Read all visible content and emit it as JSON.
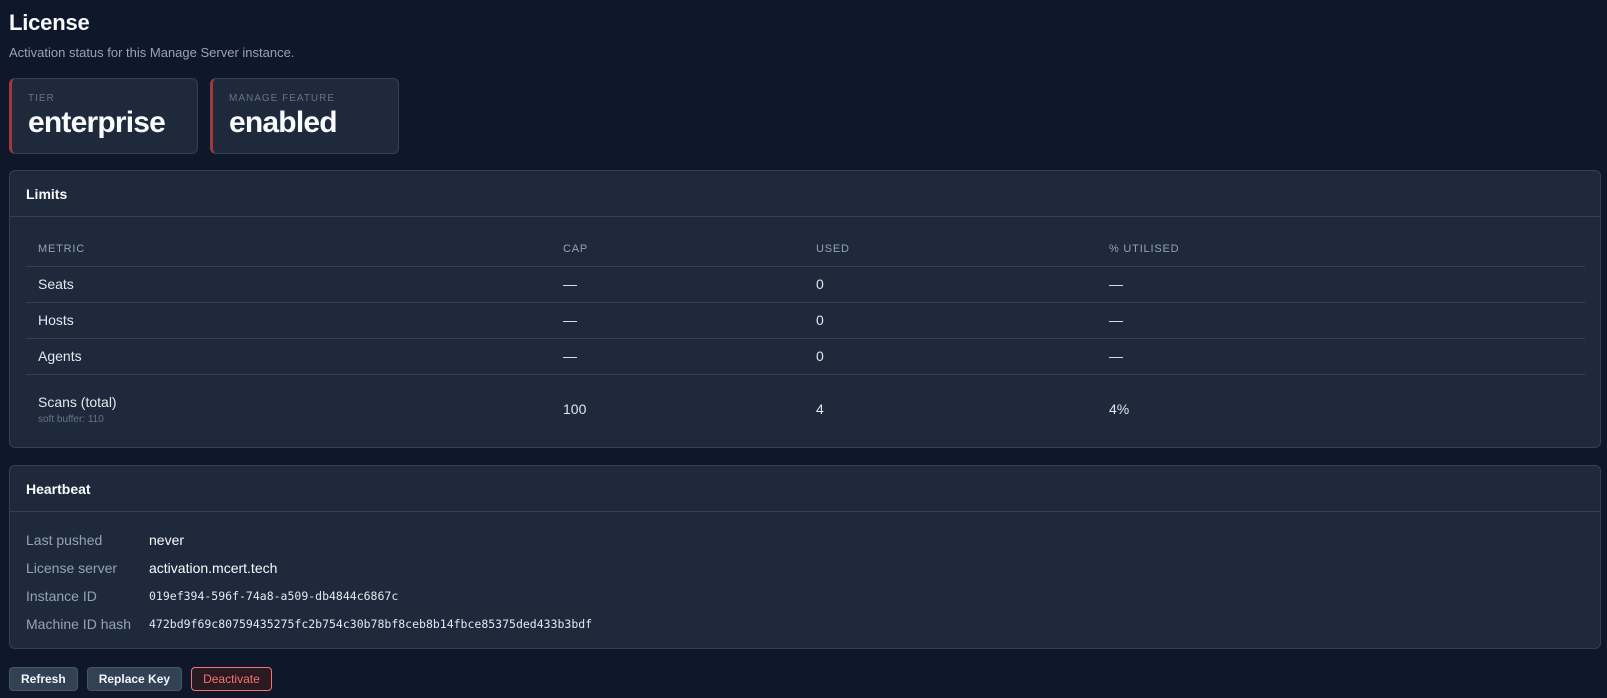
{
  "page": {
    "title": "License",
    "subtitle": "Activation status for this Manage Server instance."
  },
  "stats": [
    {
      "label": "TIER",
      "value": "enterprise"
    },
    {
      "label": "MANAGE FEATURE",
      "value": "enabled"
    }
  ],
  "limits": {
    "title": "Limits",
    "columns": [
      "METRIC",
      "CAP",
      "USED",
      "% UTILISED"
    ],
    "rows": [
      {
        "metric": "Seats",
        "sub": "",
        "cap": "—",
        "used": "0",
        "pct": "—"
      },
      {
        "metric": "Hosts",
        "sub": "",
        "cap": "—",
        "used": "0",
        "pct": "—"
      },
      {
        "metric": "Agents",
        "sub": "",
        "cap": "—",
        "used": "0",
        "pct": "—"
      },
      {
        "metric": "Scans (total)",
        "sub": "soft buffer: 110",
        "cap": "100",
        "used": "4",
        "pct": "4%"
      }
    ]
  },
  "heartbeat": {
    "title": "Heartbeat",
    "items": [
      {
        "key": "Last pushed",
        "value": "never"
      },
      {
        "key": "License server",
        "value": "activation.mcert.tech"
      },
      {
        "key": "Instance ID",
        "value": "019ef394-596f-74a8-a509-db4844c6867c"
      },
      {
        "key": "Machine ID hash",
        "value": "472bd9f69c80759435275fc2b754c30b78bf8ceb8b14fbce85375ded433b3bdf"
      }
    ]
  },
  "actions": {
    "refresh": "Refresh",
    "replace_key": "Replace Key",
    "deactivate": "Deactivate"
  },
  "colors": {
    "background": "#0f172a",
    "panel": "#1e293b",
    "accent_border": "#9f3a3a",
    "danger": "#f87171"
  }
}
